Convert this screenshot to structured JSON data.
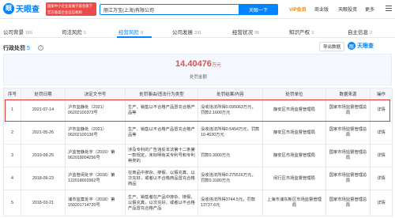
{
  "header": {
    "logo_text": "天眼查",
    "logo_glyph": "眼",
    "badge_text": "国家中小企业发展子基金旗下 官方备案企业征信机构",
    "search_value": "丽江万宝(上海)有限公司",
    "search_button": "天眼一下",
    "nav": {
      "vip": "VIP会员",
      "business": "商业版",
      "tianyan_invest": "天眼投资",
      "more": "更多"
    }
  },
  "tabs": [
    {
      "label": "公司背景",
      "count": "165"
    },
    {
      "label": "司法风险",
      "count": "5"
    },
    {
      "label": "经营风险",
      "count": "8"
    },
    {
      "label": "公司发展",
      "count": "331"
    },
    {
      "label": "经营状况",
      "count": "95"
    },
    {
      "label": "知识产权",
      "count": "3"
    },
    {
      "label": "自主信息",
      "count": "2"
    }
  ],
  "section": {
    "title": "行政处罚",
    "count": "5",
    "info_glyph": "?",
    "export_label": "导出数据",
    "watermark_text": "天眼查",
    "watermark_glyph": "眼"
  },
  "summary": {
    "amount": "14.40476",
    "unit": "万元",
    "label": "处罚金额"
  },
  "table": {
    "columns": [
      "序号",
      "处罚日期",
      "决定文书号",
      "处罚事由/违法行为类型",
      "处罚结果/内容",
      "处罚单位",
      "数据来源",
      "操作"
    ],
    "rows": [
      {
        "no": "1",
        "date": "2021-07-14",
        "doc": "沪市监静处（2021）06202100373号",
        "reason": "生产、销售以不合格产品冒充合格产品等",
        "result": "没收违法所得0.095063万元，罚款2.1600万元",
        "authority": "静安区市场监督管理局",
        "source": "国家市场监督管理总局",
        "action": "详情"
      },
      {
        "no": "2",
        "date": "2021-05-26",
        "doc": "沪市监静处（2021）06202100136号",
        "reason": "生产、销售以不合格产品冒充合格产品等",
        "result": "没收违法所得0.5454万元，罚款10.4530万元",
        "authority": "静安区市场监督管理局",
        "source": "国家市场监督管理总局",
        "action": "详情"
      },
      {
        "no": "3",
        "date": "2019-09-25",
        "doc": "沪监管静处字（2019）第062018004256号",
        "reason": "涉及专利的广告违反本法第十二条第一款规定，未标明有关专利号和专利种类的",
        "result": "罚款0.3000万元",
        "authority": "静安区市场监督管理局",
        "source": "国家市场监督管理总局",
        "action": "详情"
      },
      {
        "no": "4",
        "date": "2018-09-23",
        "doc": "沪监管闵处字（2018）第122018002962号",
        "reason": "在商品中掺杂、掺假，以假充真、以次充好，或者以不合格商品冒充合格商品",
        "result": "没收违法所得0.275516万元，罚款0.3180万元",
        "authority": "闵行区市场监督管理局",
        "source": "国家市场监督管理总局",
        "action": "详情"
      },
      {
        "no": "5",
        "date": "2018-03-21",
        "doc": "浦市监案处字（2018）第150201714720号",
        "reason": "生产、销售者在产品中掺杂、掺假，以假充真，以次充好，或者以不合格产品冒充合格产品",
        "result": "没收违法所得3744.5元，罚款13737.6元",
        "authority": "上海市浦东新区市场监督管理局",
        "source": "国家市场监督管理总局",
        "action": "详情"
      }
    ]
  }
}
